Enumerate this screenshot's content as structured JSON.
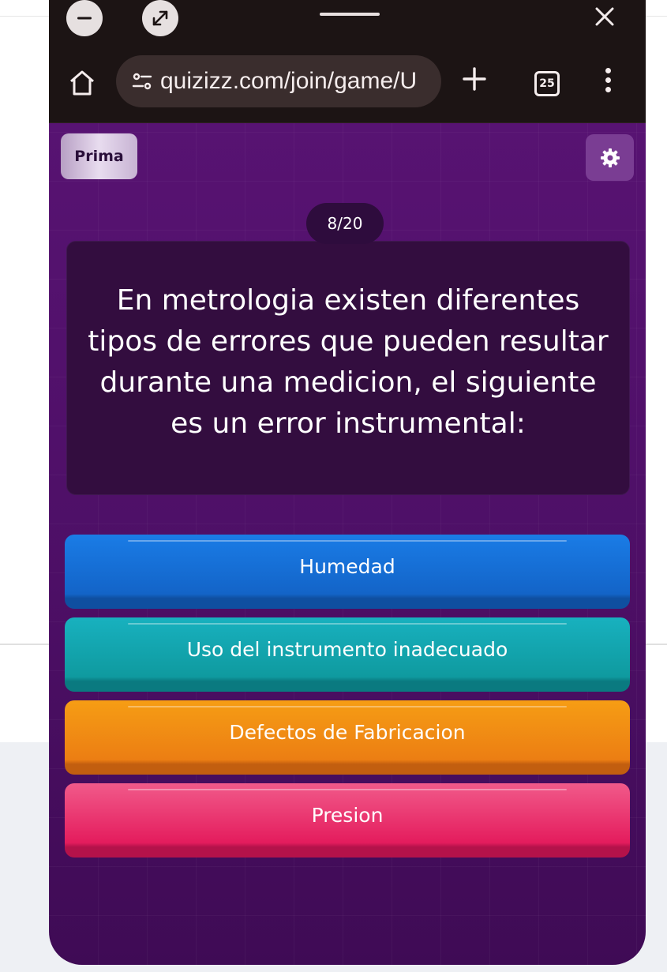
{
  "browser": {
    "url": "quizizz.com/join/game/U",
    "tab_count": "25"
  },
  "quiz": {
    "mode_label": "Prima",
    "progress": "8/20",
    "question": "En metrologia existen diferentes tipos de errores que pueden resultar durante una medicion, el siguiente es un error instrumental:",
    "answers": [
      {
        "label": "Humedad",
        "color": "#1a6fd8"
      },
      {
        "label": "Uso del instrumento inadecuado",
        "color": "#13a4ad"
      },
      {
        "label": "Defectos de Fabricacion",
        "color": "#f08a13"
      },
      {
        "label": "Presion",
        "color": "#e9336f"
      }
    ]
  },
  "colors": {
    "quiz_background": "#52116b",
    "question_box": "#330d3f",
    "browser_chrome": "#1c1414"
  },
  "icons": [
    "minimize-icon",
    "expand-icon",
    "close-icon",
    "home-icon",
    "site-info-icon",
    "plus-icon",
    "tabs-icon",
    "menu-icon",
    "gear-icon"
  ]
}
